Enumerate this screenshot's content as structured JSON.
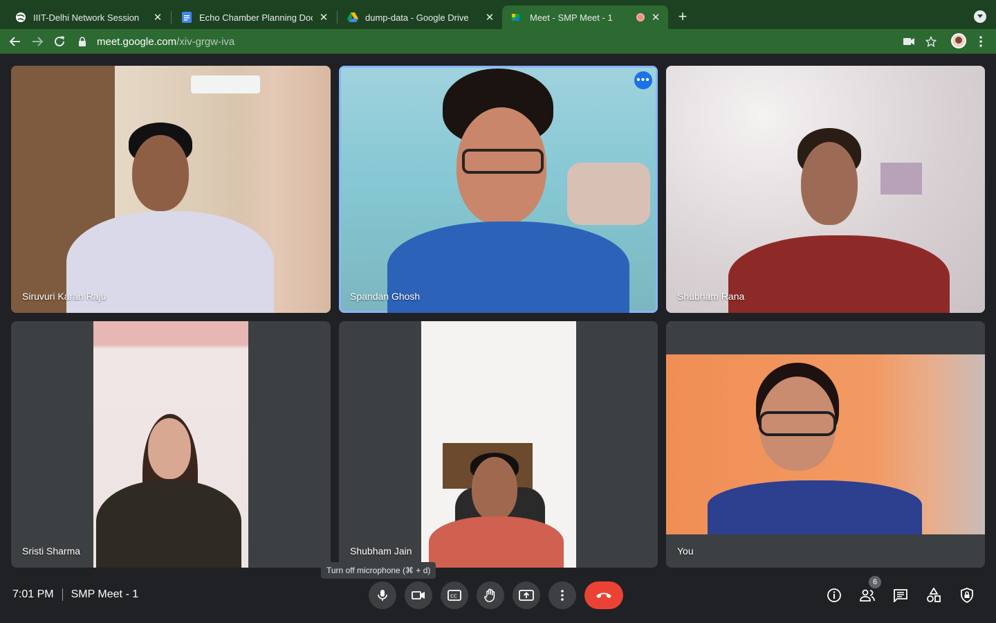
{
  "browser": {
    "tabs": [
      {
        "title": "IIIT-Delhi Network Session",
        "icon": "globe-icon"
      },
      {
        "title": "Echo Chamber Planning Document",
        "icon": "google-docs-icon"
      },
      {
        "title": "dump-data - Google Drive",
        "icon": "google-drive-icon"
      },
      {
        "title": "Meet - SMP Meet - 1",
        "icon": "google-meet-icon",
        "recording": true
      }
    ],
    "url_host": "meet.google.com",
    "url_path": "/xiv-grgw-iva"
  },
  "participants": [
    {
      "name": "Siruvuri Karan Raju"
    },
    {
      "name": "Spandan Ghosh",
      "pinned": true
    },
    {
      "name": "Shubham Rana"
    },
    {
      "name": "Sristi Sharma"
    },
    {
      "name": "Shubham Jain"
    },
    {
      "name": "You"
    }
  ],
  "meeting": {
    "time": "7:01 PM",
    "title": "SMP Meet - 1",
    "participant_count": "6",
    "mic_tooltip": "Turn off microphone (⌘ + d)"
  },
  "colors": {
    "browser_frame": "#1d4222",
    "browser_toolbar": "#2d6a32",
    "meet_background": "#202124",
    "control_button": "#3c4043",
    "hangup": "#ea4335",
    "pinned_outline": "#8ab4f8"
  }
}
